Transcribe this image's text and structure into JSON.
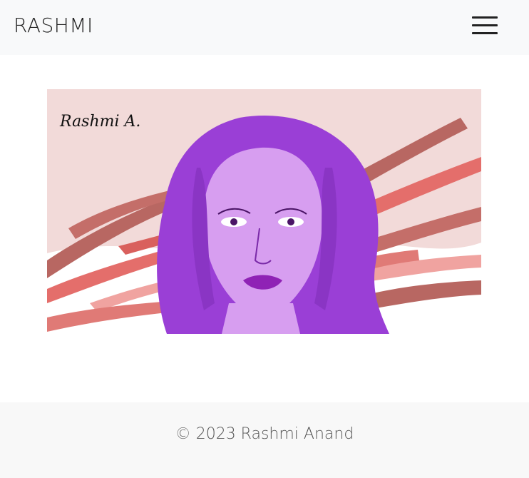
{
  "navbar": {
    "brand": "RASHMI",
    "menu_icon": "hamburger-menu-icon"
  },
  "artwork": {
    "description_icon": "portrait-illustration",
    "signature": "Rashmi A.",
    "colors": {
      "background": "#f2dad9",
      "skin": "#d79ef0",
      "hair": "#9a3fd6",
      "lips": "#8f22b5",
      "stroke_dark": "#b86762",
      "stroke_coral": "#e46e6b",
      "stroke_pink": "#f0a3a0"
    }
  },
  "footer": {
    "copyright": "© 2023 Rashmi Anand"
  }
}
